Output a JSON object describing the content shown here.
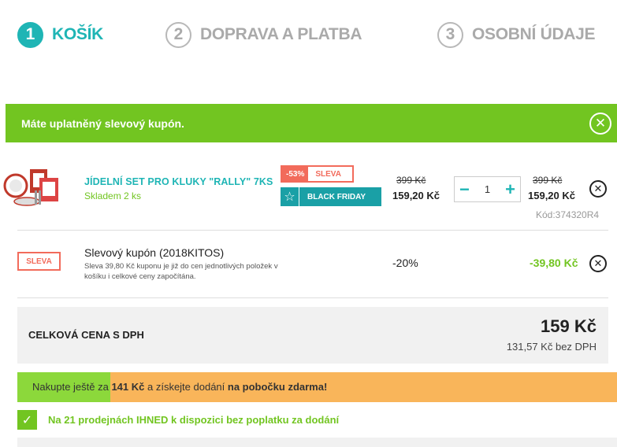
{
  "steps": [
    {
      "num": "1",
      "label": "KOŠÍK",
      "active": true
    },
    {
      "num": "2",
      "label": "DOPRAVA A PLATBA",
      "active": false
    },
    {
      "num": "3",
      "label": "OSOBNÍ ÚDAJE",
      "active": false
    }
  ],
  "banner": {
    "text": "Máte uplatněný slevový kupón.",
    "close": "✕"
  },
  "product": {
    "name": "JÍDELNÍ SET PRO KLUKY \"RALLY\" 7KS",
    "stock": "Skladem 2 ks",
    "discount_pct": "-53%",
    "sleva_label": "SLEVA",
    "bf_label": "BLACK FRIDAY",
    "unit_old": "399 Kč",
    "unit_price": "159,20 Kč",
    "qty": "1",
    "qty_minus": "−",
    "qty_plus": "+",
    "total_old": "399 Kč",
    "total_price": "159,20 Kč",
    "code": "Kód:374320R4",
    "remove": "✕"
  },
  "coupon": {
    "tag": "SLEVA",
    "name": "Slevový kupón (2018KITOS)",
    "desc": "Sleva 39,80 Kč kuponu je již do cen jednotlivých položek v košíku i celkové ceny započítána.",
    "pct": "-20%",
    "value": "-39,80 Kč",
    "remove": "✕"
  },
  "total": {
    "label": "CELKOVÁ CENA S DPH",
    "sum": "159 Kč",
    "without_vat": "131,57 Kč bez DPH"
  },
  "shipping": {
    "pre": "Nakupte ještě za ",
    "amount": "141 Kč",
    "mid": " a získejte dodání ",
    "target": "na pobočku zdarma!",
    "progress": 0.155
  },
  "availability": {
    "check": "✓",
    "text": "Na 21 prodejnách IHNED k dispozici bez poplatku za dodání"
  },
  "colors": {
    "teal": "#1fb5b5",
    "green": "#72c521",
    "red": "#f26b5b",
    "orange": "#f9b55a"
  }
}
